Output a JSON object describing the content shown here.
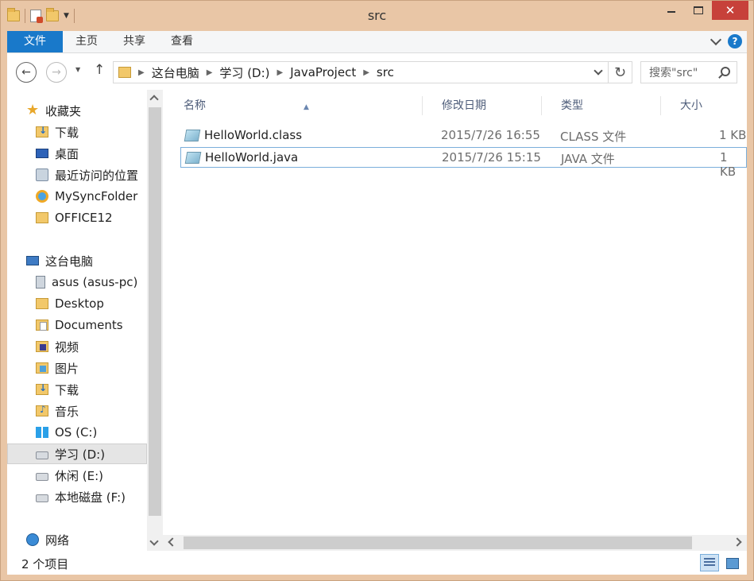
{
  "window": {
    "title": "src",
    "controls": {
      "minimize": "minimize-icon",
      "maximize": "maximize-icon",
      "close": "✕"
    }
  },
  "ribbon": {
    "tabs": [
      {
        "label": "文件"
      },
      {
        "label": "主页"
      },
      {
        "label": "共享"
      },
      {
        "label": "查看"
      }
    ],
    "help": "?"
  },
  "nav": {
    "breadcrumbs": [
      "这台电脑",
      "学习 (D:)",
      "JavaProject",
      "src"
    ],
    "search_placeholder": "搜索\"src\""
  },
  "sidebar": {
    "items": [
      {
        "label": "收藏夹",
        "icon": "star-icon"
      },
      {
        "label": "下载",
        "icon": "downloads-folder-icon"
      },
      {
        "label": "桌面",
        "icon": "desktop-icon"
      },
      {
        "label": "最近访问的位置",
        "icon": "recent-places-icon"
      },
      {
        "label": "MySyncFolder",
        "icon": "sync-folder-icon"
      },
      {
        "label": "OFFICE12",
        "icon": "folder-icon"
      },
      {
        "label": "这台电脑",
        "icon": "computer-icon"
      },
      {
        "label": "asus (asus-pc)",
        "icon": "user-icon"
      },
      {
        "label": "Desktop",
        "icon": "folder-icon"
      },
      {
        "label": "Documents",
        "icon": "documents-icon"
      },
      {
        "label": "视频",
        "icon": "videos-icon"
      },
      {
        "label": "图片",
        "icon": "pictures-icon"
      },
      {
        "label": "下载",
        "icon": "downloads-folder-icon"
      },
      {
        "label": "音乐",
        "icon": "music-icon"
      },
      {
        "label": "OS (C:)",
        "icon": "windows-drive-icon"
      },
      {
        "label": "学习 (D:)",
        "icon": "drive-icon",
        "selected": true
      },
      {
        "label": "休闲 (E:)",
        "icon": "drive-icon"
      },
      {
        "label": "本地磁盘 (F:)",
        "icon": "drive-icon"
      },
      {
        "label": "网络",
        "icon": "network-icon"
      }
    ]
  },
  "files": {
    "columns": {
      "name": "名称",
      "date": "修改日期",
      "type": "类型",
      "size": "大小"
    },
    "rows": [
      {
        "name": "HelloWorld.class",
        "date": "2015/7/26 16:55",
        "type": "CLASS 文件",
        "size": "1 KB"
      },
      {
        "name": "HelloWorld.java",
        "date": "2015/7/26 15:15",
        "type": "JAVA 文件",
        "size": "1 KB",
        "selected": true
      }
    ]
  },
  "status": {
    "item_count": "2 个项目"
  }
}
